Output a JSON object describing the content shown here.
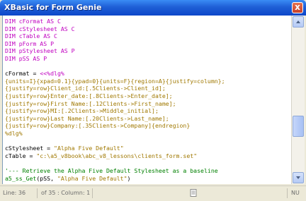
{
  "window": {
    "title": "XBasic for Form Genie",
    "close_label": "x"
  },
  "editor": {
    "lines": [
      [
        {
          "t": "DIM cFormat AS C",
          "c": "kw"
        }
      ],
      [
        {
          "t": "DIM cStylesheet AS C",
          "c": "kw"
        }
      ],
      [
        {
          "t": "DIM cTable AS C",
          "c": "kw"
        }
      ],
      [
        {
          "t": "DIM pForm AS P",
          "c": "kw"
        }
      ],
      [
        {
          "t": "DIM pStylesheet AS P",
          "c": "kw"
        }
      ],
      [
        {
          "t": "DIM pSS AS P",
          "c": "kw"
        }
      ],
      [
        {
          "t": "",
          "c": "var"
        }
      ],
      [
        {
          "t": "cFormat",
          "c": "var"
        },
        {
          "t": " = ",
          "c": "var"
        },
        {
          "t": "<<%dlg%",
          "c": "kw"
        }
      ],
      [
        {
          "t": "{units=I}{xpad=0.1}{ypad=0}{units=F}{region=A}{justify=column};",
          "c": "gold"
        }
      ],
      [
        {
          "t": "{justify=row}Client_id:[.5Clients->Client_id];",
          "c": "gold"
        }
      ],
      [
        {
          "t": "{justify=row}Enter_date:[.8Clients->Enter_date];",
          "c": "gold"
        }
      ],
      [
        {
          "t": "{justify=row}First Name:[.12Clients->First_name];",
          "c": "gold"
        }
      ],
      [
        {
          "t": "{justify=row}MI:[.2Clients->Middle_initial];",
          "c": "gold"
        }
      ],
      [
        {
          "t": "{justify=row}Last Name:[.20Clients->Last_name];",
          "c": "gold"
        }
      ],
      [
        {
          "t": "{justify=row}Company:[.35Clients->Company]{endregion}",
          "c": "gold"
        }
      ],
      [
        {
          "t": "%dlg%",
          "c": "gold"
        }
      ],
      [
        {
          "t": "",
          "c": "var"
        }
      ],
      [
        {
          "t": "cStylesheet",
          "c": "var"
        },
        {
          "t": " = ",
          "c": "var"
        },
        {
          "t": "\"Alpha Five Default\"",
          "c": "gold"
        }
      ],
      [
        {
          "t": "cTable",
          "c": "var"
        },
        {
          "t": " = ",
          "c": "var"
        },
        {
          "t": "\"c:\\a5_v8book\\abc_v8_lessons\\clients_form.set\"",
          "c": "gold"
        }
      ],
      [
        {
          "t": "",
          "c": "var"
        }
      ],
      [
        {
          "t": "'--- Retrieve the Alpha Five Default Stylesheet as a baseline",
          "c": "cmt"
        }
      ],
      [
        {
          "t": "a5_ss_Get",
          "c": "cmt"
        },
        {
          "t": "(pSS, ",
          "c": "var"
        },
        {
          "t": "\"Alpha Five Default\"",
          "c": "gold"
        },
        {
          "t": ")",
          "c": "var"
        }
      ]
    ]
  },
  "statusbar": {
    "line": "Line: 36",
    "of_col": "of 35 : Column: 1",
    "mode": "NU"
  },
  "colors": {
    "title_gradient_top": "#3a8cf5",
    "title_gradient_bottom": "#0d47c9",
    "keyword": "#c000c0",
    "string": "#a07800",
    "comment": "#008000"
  }
}
